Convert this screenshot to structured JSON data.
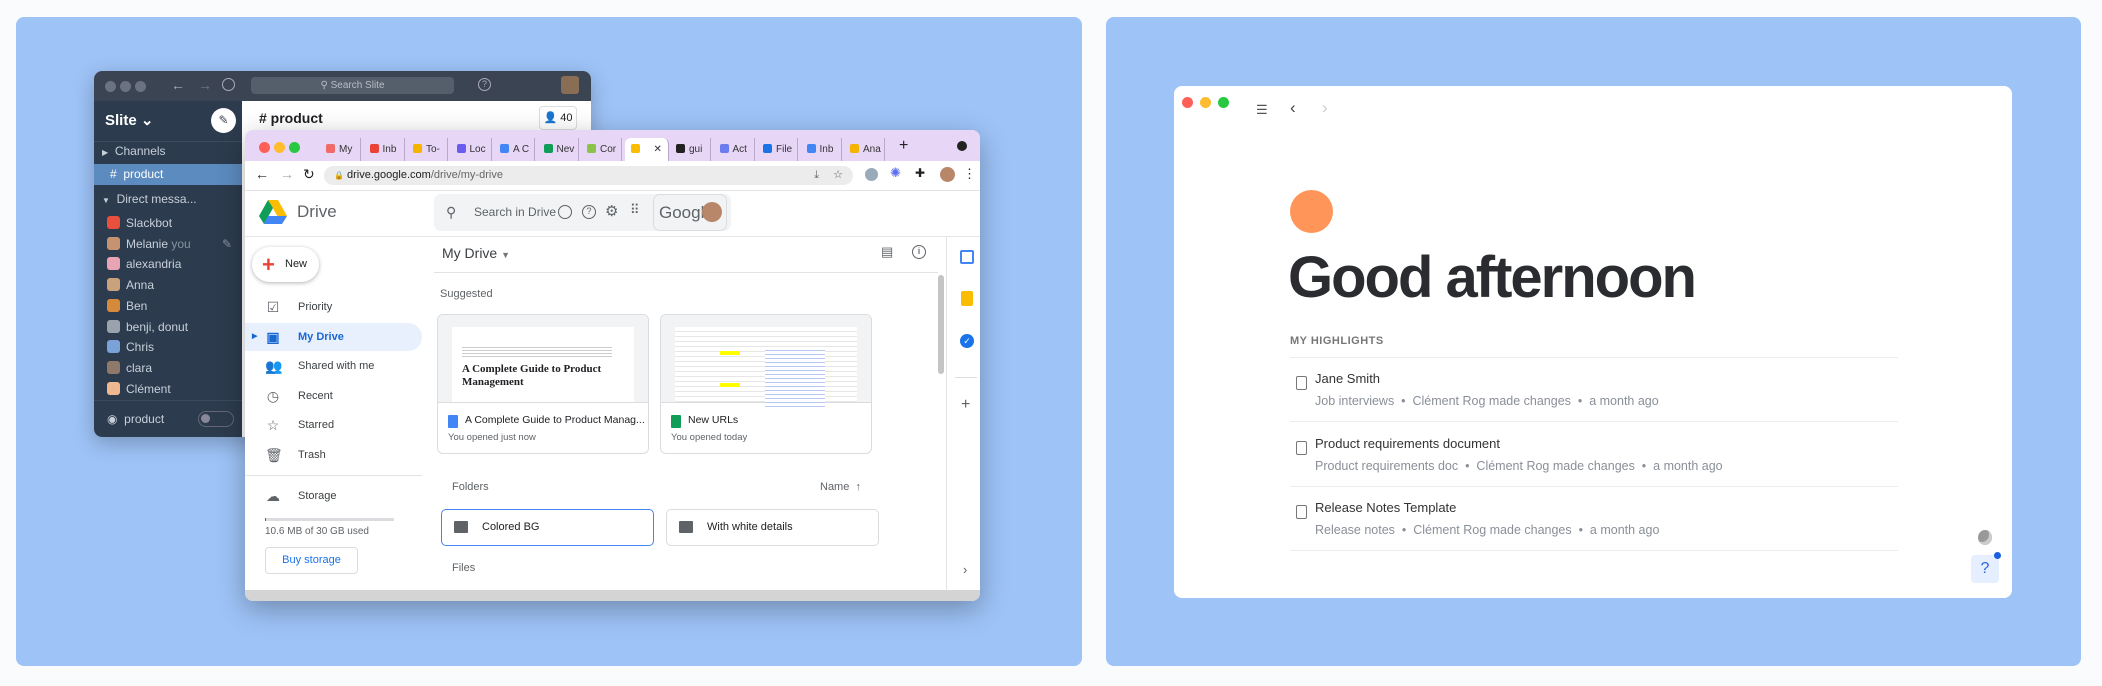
{
  "colors": {
    "panel": "#9ec3f7",
    "slite_sidebar": "#2c3b4e",
    "chrome_tabbar": "#e8d6f7",
    "drive_accent": "#1a73e8",
    "avatar_orange": "#ff9559"
  },
  "slite": {
    "search_placeholder": "Search Slite",
    "workspace": "Slite",
    "channels_label": "Channels",
    "active_channel": "product",
    "dm_label": "Direct messa...",
    "dms": [
      {
        "name": "Slackbot"
      },
      {
        "name": "Melanie",
        "suffix": "you"
      },
      {
        "name": "alexandria"
      },
      {
        "name": "Anna"
      },
      {
        "name": "Ben"
      },
      {
        "name": "benji, donut"
      },
      {
        "name": "Chris"
      },
      {
        "name": "clara"
      },
      {
        "name": "Clément"
      }
    ],
    "footer_channel": "product",
    "channel_title": "# product",
    "member_count": "40"
  },
  "chrome": {
    "tabs": [
      "My",
      "Inb",
      "To-",
      "Loc",
      "A C",
      "Nev",
      "Cor",
      "",
      "gui",
      "Act",
      "File",
      "Inb",
      "Ana"
    ],
    "url_domain": "drive.google.com",
    "url_path": "/drive/my-drive"
  },
  "drive": {
    "app_name": "Drive",
    "search_placeholder": "Search in Drive",
    "google_label": "Google",
    "new_label": "New",
    "nav": [
      {
        "label": "Priority",
        "icon": "priority-icon"
      },
      {
        "label": "My Drive",
        "icon": "my-drive-icon"
      },
      {
        "label": "Shared with me",
        "icon": "shared-icon"
      },
      {
        "label": "Recent",
        "icon": "clock-icon"
      },
      {
        "label": "Starred",
        "icon": "star-icon"
      },
      {
        "label": "Trash",
        "icon": "trash-icon"
      }
    ],
    "storage_label": "Storage",
    "storage_used": "10.6 MB of 30 GB used",
    "storage_fraction": 0.0004,
    "buy_storage": "Buy storage",
    "title": "My Drive",
    "suggested_label": "Suggested",
    "suggested": [
      {
        "title": "A Complete Guide to Product Manag...",
        "subtitle": "You opened just now",
        "preview_heading": "A Complete Guide to Product Management",
        "type": "doc"
      },
      {
        "title": "New URLs",
        "subtitle": "You opened today",
        "type": "sheet"
      }
    ],
    "folders_label": "Folders",
    "sort_label": "Name",
    "folders": [
      "Colored BG",
      "With white details"
    ],
    "files_label": "Files"
  },
  "home": {
    "greeting": "Good afternoon",
    "highlights_label": "MY HIGHLIGHTS",
    "highlights": [
      {
        "title": "Jane Smith",
        "collection": "Job interviews",
        "activity": "Clément Rog made changes",
        "time": "a month ago"
      },
      {
        "title": "Product requirements document",
        "collection": "Product requirements doc",
        "activity": "Clément Rog made changes",
        "time": "a month ago"
      },
      {
        "title": "Release Notes Template",
        "collection": "Release notes",
        "activity": "Clément Rog made changes",
        "time": "a month ago"
      }
    ],
    "help_label": "?"
  }
}
